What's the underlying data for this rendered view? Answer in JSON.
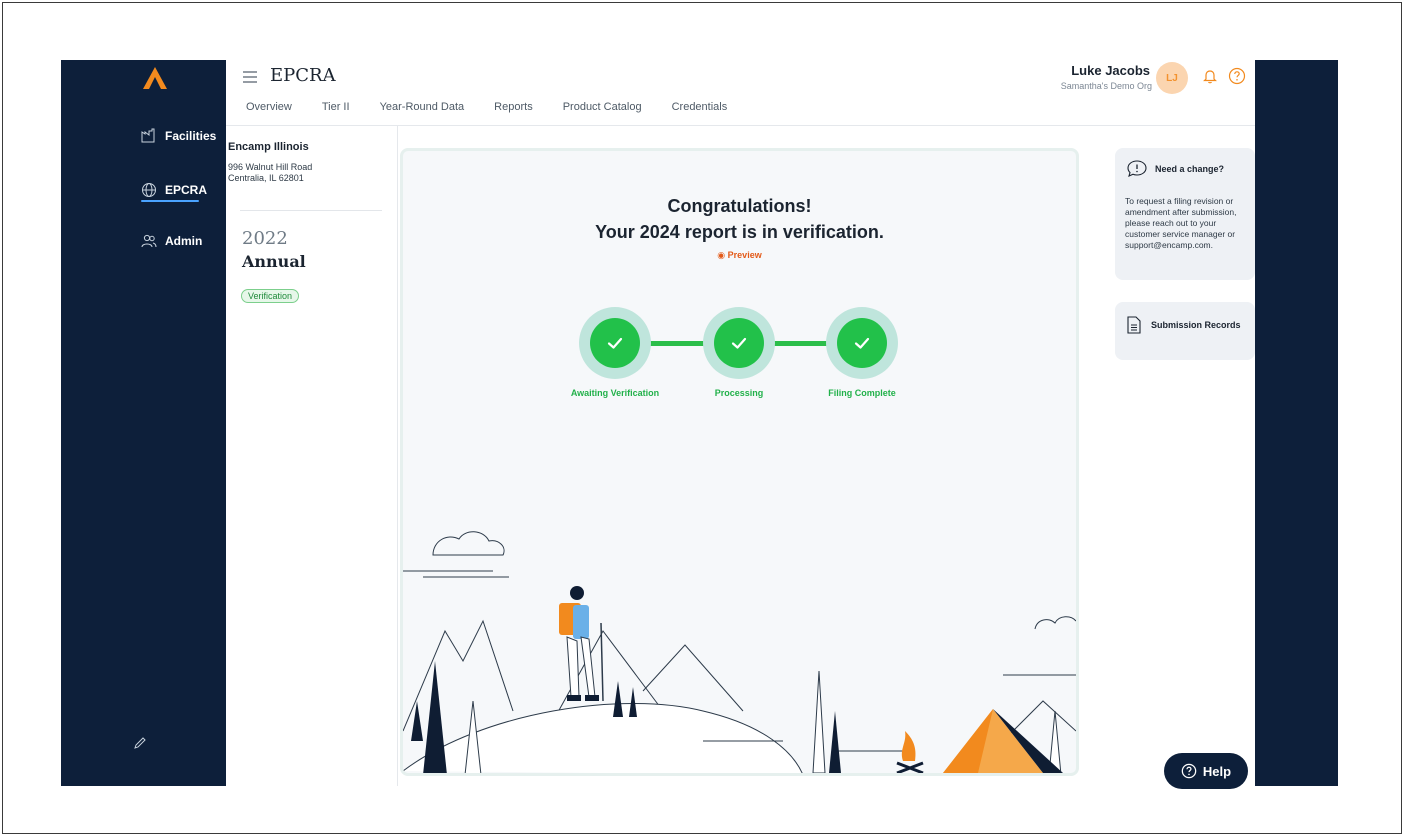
{
  "app": {
    "title": "EPCRA"
  },
  "sidebar": {
    "items": [
      {
        "label": "Facilities",
        "icon": "factory-icon"
      },
      {
        "label": "EPCRA",
        "icon": "globe-icon",
        "active": true
      },
      {
        "label": "Admin",
        "icon": "users-icon"
      }
    ]
  },
  "tabs": [
    "Overview",
    "Tier II",
    "Year-Round Data",
    "Reports",
    "Product Catalog",
    "Credentials"
  ],
  "user": {
    "name": "Luke Jacobs",
    "org": "Samantha's Demo Org",
    "initials": "LJ"
  },
  "facility": {
    "name": "Encamp Illinois",
    "address": "996 Walnut Hill Road\nCentralia, IL 62801",
    "year": "2022",
    "type": "Annual",
    "status": "Verification"
  },
  "main": {
    "heading_line1": "Congratulations!",
    "heading_line2": "Your 2024 report is in verification.",
    "preview_label": "Preview",
    "steps": [
      {
        "label": "Awaiting Verification",
        "done": true
      },
      {
        "label": "Processing",
        "done": true
      },
      {
        "label": "Filing Complete",
        "done": true
      }
    ]
  },
  "info": {
    "title": "Need a change?",
    "text": "To request a filing revision or amendment after submission, please reach out to your customer service manager or support@encamp.com."
  },
  "records": {
    "title": "Submission Records"
  },
  "help": {
    "label": "Help"
  },
  "colors": {
    "navy": "#0d1f3a",
    "accent_orange": "#f28a1e",
    "success_green": "#22c14a",
    "step_ring": "#bfe5dc"
  }
}
